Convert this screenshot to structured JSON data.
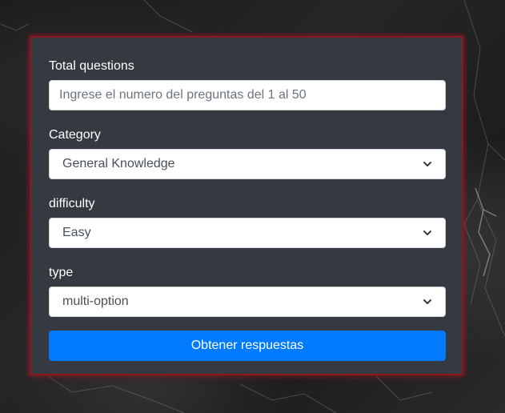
{
  "form": {
    "total_questions": {
      "label": "Total questions",
      "placeholder": "Ingrese el numero del preguntas del 1 al 50",
      "value": ""
    },
    "category": {
      "label": "Category",
      "selected": "General Knowledge"
    },
    "difficulty": {
      "label": "difficulty",
      "selected": "Easy"
    },
    "type": {
      "label": "type",
      "selected": "multi-option"
    },
    "submit_label": "Obtener respuestas"
  },
  "icons": {
    "select_chevron": "chevron-down-icon"
  },
  "colors": {
    "card_background": "#343a40",
    "card_border": "#8a1820",
    "button_primary": "#007bff",
    "text_light": "#ffffff"
  }
}
